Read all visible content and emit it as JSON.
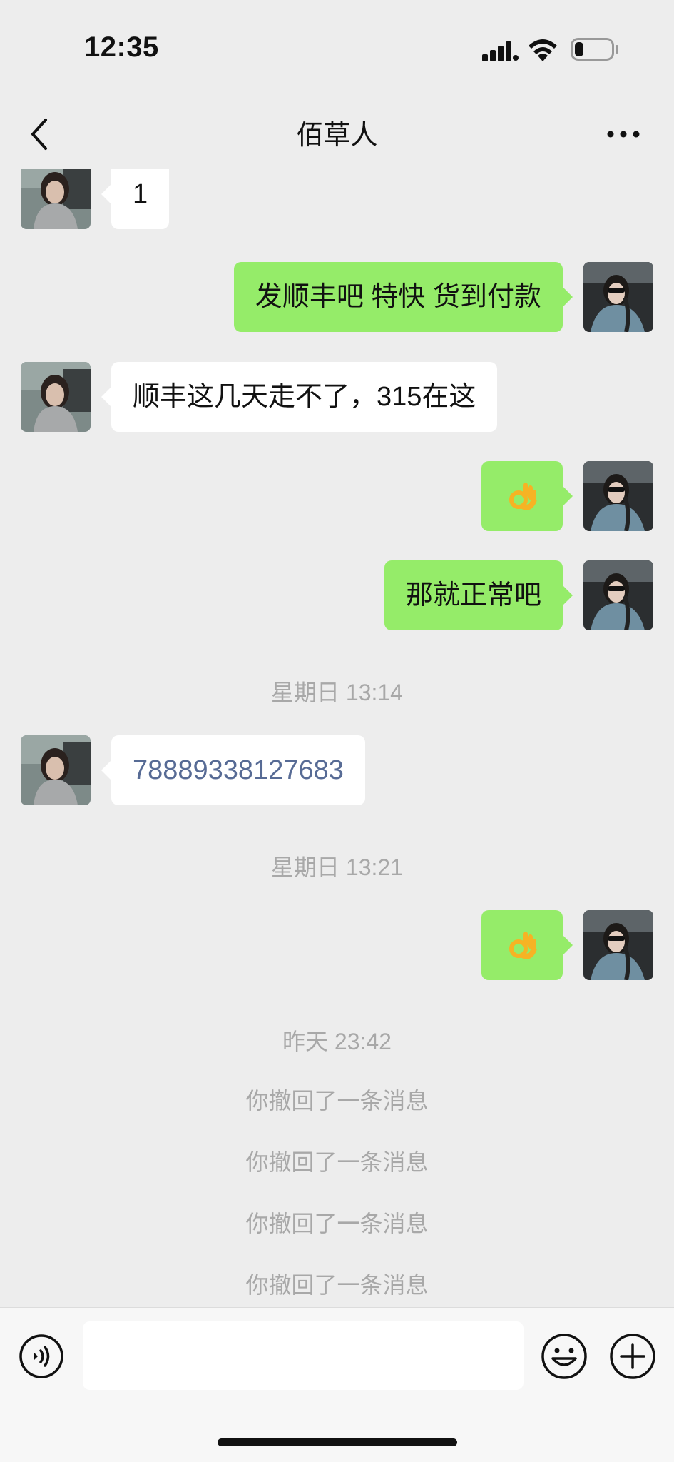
{
  "status_bar": {
    "time": "12:35",
    "battery_level": 0.25
  },
  "nav": {
    "title": "佰草人"
  },
  "messages": [
    {
      "side": "left",
      "text": "1"
    },
    {
      "side": "right",
      "text": "发顺丰吧  特快 货到付款"
    },
    {
      "side": "left",
      "text": "顺丰这几天走不了，315在这"
    },
    {
      "side": "right",
      "emoji": "ok-hand"
    },
    {
      "side": "right",
      "text": "那就正常吧"
    },
    {
      "side": "left",
      "text": "78889338127683",
      "is_link": true
    },
    {
      "side": "right",
      "emoji": "ok-hand"
    }
  ],
  "timestamps": [
    "星期日 13:14",
    "星期日 13:21",
    "昨天 23:42"
  ],
  "recalls": [
    "你撤回了一条消息",
    "你撤回了一条消息",
    "你撤回了一条消息",
    "你撤回了一条消息"
  ],
  "input": {
    "value": "",
    "placeholder": ""
  },
  "icons": {
    "status": [
      "signal-icon",
      "wifi-icon",
      "battery-icon"
    ],
    "nav": [
      "back-icon",
      "more-icon"
    ],
    "input_bar": [
      "voice-icon",
      "emoji-icon",
      "plus-icon"
    ]
  },
  "colors": {
    "background": "#ededed",
    "sent_bubble": "#95ec69",
    "received_bubble": "#ffffff",
    "link": "#576b95",
    "system_text": "#a8a8a8"
  }
}
